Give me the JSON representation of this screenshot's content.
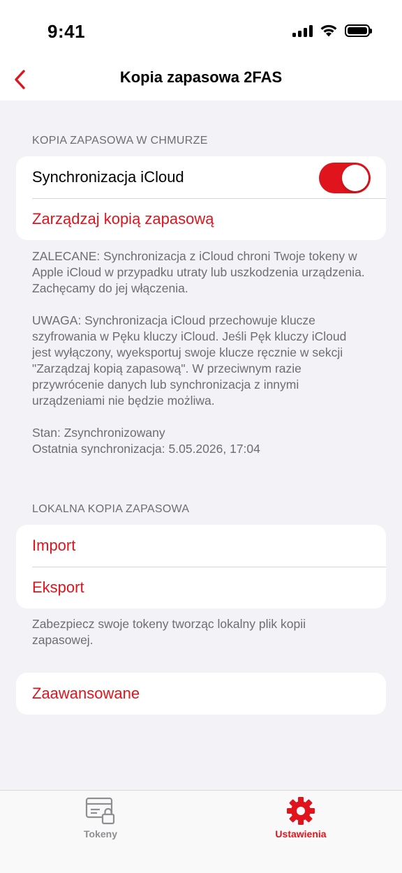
{
  "status_bar": {
    "time": "9:41"
  },
  "nav": {
    "title": "Kopia zapasowa 2FAS"
  },
  "cloud_section": {
    "header": "KOPIA ZAPASOWA W CHMURZE",
    "sync_label": "Synchronizacja iCloud",
    "sync_enabled": true,
    "manage_label": "Zarządzaj kopią zapasową",
    "recommended_text": "ZALECANE: Synchronizacja z iCloud chroni Twoje tokeny w Apple iCloud w przypadku utraty lub uszkodzenia urządzenia. Zachęcamy do jej włączenia.",
    "warning_text": "UWAGA: Synchronizacja iCloud przechowuje klucze szyfrowania w Pęku kluczy iCloud. Jeśli Pęk kluczy iCloud jest wyłączony, wyeksportuj swoje klucze ręcznie w sekcji \"Zarządzaj kopią zapasową\". W przeciwnym razie przywrócenie danych lub synchronizacja z innymi urządzeniami nie będzie możliwa.",
    "status_text": "Stan: Zsynchronizowany",
    "last_sync_text": "Ostatnia synchronizacja: 5.05.2026, 17:04"
  },
  "local_section": {
    "header": "LOKALNA KOPIA ZAPASOWA",
    "import_label": "Import",
    "export_label": "Eksport",
    "footer_text": "Zabezpiecz swoje tokeny tworząc lokalny plik kopii zapasowej."
  },
  "advanced": {
    "label": "Zaawansowane"
  },
  "tab_bar": {
    "tokens_label": "Tokeny",
    "settings_label": "Ustawienia",
    "active": "settings"
  },
  "colors": {
    "accent": "#e0141c",
    "background": "#f2f2f7",
    "secondary_text": "#6d6d72",
    "inactive_tab": "#8e8e93"
  }
}
